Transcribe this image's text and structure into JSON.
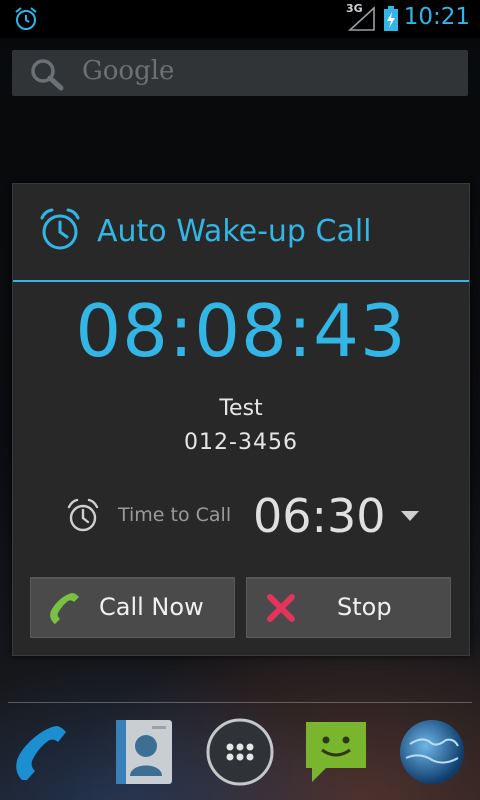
{
  "status_bar": {
    "time": "10:21",
    "network": "3G",
    "icons": [
      "alarm-icon",
      "signal-icon",
      "battery-charging-icon"
    ]
  },
  "search": {
    "placeholder": "Google",
    "icon": "search-icon"
  },
  "dialog": {
    "title": "Auto Wake-up Call",
    "icon": "alarm-clock-icon",
    "countdown": "08:08:43",
    "contact_name": "Test",
    "contact_number": "012-3456",
    "time_to_call_label": "Time to Call",
    "time_to_call_value": "06:30",
    "buttons": {
      "call_now": "Call Now",
      "stop": "Stop"
    }
  },
  "dock": {
    "items": [
      "phone-icon",
      "contacts-icon",
      "app-drawer-icon",
      "messaging-icon",
      "browser-icon"
    ]
  },
  "colors": {
    "accent": "#33b5e5",
    "dialog_bg": "#282828",
    "button_bg": "#4a4a4a",
    "call_green": "#7ac142",
    "stop_red": "#e4335c"
  }
}
